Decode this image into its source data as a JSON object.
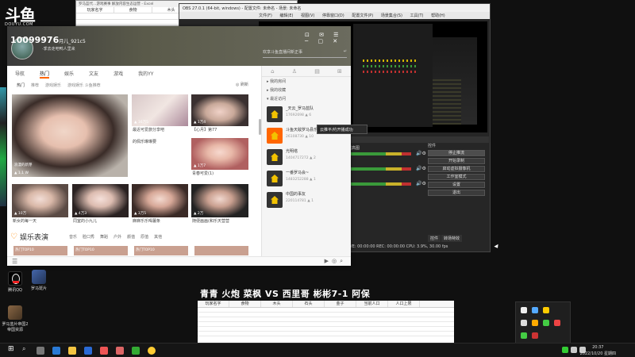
{
  "logo": {
    "mark": "斗鱼",
    "sub": "DOUYU.COM"
  },
  "sheet_top": {
    "title": "罗马蓝代…游戏赛事 解放内容生态运营 - Excel",
    "headers": [
      "玩家名字",
      "食物",
      "木头",
      "",
      ""
    ]
  },
  "obs": {
    "title": "OBS 27.0.1 (64-bit, windows) - 配置文件: 未命名 - 场景: 未命名",
    "menu": [
      "文件(F)",
      "编辑(E)",
      "视图(V)",
      "停靠窗口(D)",
      "配置文件(P)",
      "场景集合(S)",
      "工具(T)",
      "帮助(H)"
    ],
    "dock_tabs": "场景  来源  混音器  场景过渡  控件",
    "mixer": [
      {
        "label": "提高图",
        "level": 0.85
      },
      {
        "label": "",
        "level": 0.75
      },
      {
        "label": "",
        "level": 0.7
      }
    ],
    "controls": [
      "停止推流",
      "开始录制",
      "启动虚拟摄像机",
      "工作室模式",
      "设置",
      "退出"
    ],
    "tabs": [
      "控件",
      "转场特效"
    ],
    "status": "LIVE: 00:00:00   REC: 00:00:00   CPU: 3.9%, 30.00 fps"
  },
  "client": {
    "uid": "10099976",
    "uid_suffix": "月儿_921c5",
    "sign": "·季去走吧鸭人里来",
    "search_placeholder": "欢享斗鱼直播间新正事",
    "winbtns": "⊡ ✉ ☰ ─ ▢ ✕",
    "nav": [
      "导航",
      "热门",
      "娱乐",
      "文友",
      "游戏",
      "我的YY"
    ],
    "subnav": [
      "热门",
      "推荐",
      "游戏娱乐",
      "游戏娱乐 斗鱼推荐"
    ],
    "refresh": "◎ 刷新",
    "tiles": [
      {
        "overlay": "▲ 1.1 W",
        "caption": "",
        "badge": "浪漫的新芽"
      },
      {
        "overlay": "▲ 16万5",
        "caption": "最近可爱旅分享吧"
      },
      {
        "overlay": "▲ 1万4",
        "caption": "【心月】第77"
      },
      {
        "overlay": "",
        "caption": "的佩乐琳琳要"
      },
      {
        "overlay": "▲ 1万7",
        "caption": "青春可爱(1)"
      },
      {
        "overlay": "▲ 10万",
        "caption": "新女的每一天"
      },
      {
        "overlay": "▲ 4万3",
        "caption": "同室的小九儿"
      },
      {
        "overlay": "▲ 3万5",
        "caption": "麻麻乐乐喝薯条"
      },
      {
        "overlay": "▲ 2万",
        "caption": "随便画画(和乐天营营"
      }
    ],
    "section_title": "娱乐表演",
    "section_tabs": [
      "音乐",
      "脸口秀",
      "舞蹈",
      "户外",
      "颜值",
      "原值",
      "其他"
    ],
    "next_row": [
      "热门TOP10",
      "热门TOP10",
      "热门TOP10",
      ""
    ],
    "side_links": [
      "我的房间",
      "我的收藏",
      "最近访问"
    ],
    "side_items": [
      {
        "name": "_天云_罗马蓝队",
        "views": "17692698 ▲ 6"
      },
      {
        "name": "斗鱼天敌罗马县乐楼",
        "views": "26108730 ▲ 10"
      },
      {
        "name": "光明塔",
        "views": "1404717272 ▲ 2"
      },
      {
        "name": "一番罗马会~",
        "views": "1483252288 ▲ 1"
      },
      {
        "name": "中国的事友",
        "views": "220114781 ▲ 1"
      }
    ]
  },
  "tooltip": "云推平/约开播成功",
  "banner": "青青 火炮 菜枫 VS 西里哥 彬彬7-1 阿保",
  "sheet": {
    "headers": [
      "玩家名字",
      "食物",
      "木头",
      "石头",
      "金子",
      "当前人口",
      "人口上限"
    ]
  },
  "desktop_icons": [
    {
      "label": "腾讯QQ"
    },
    {
      "label": "罗马斑片"
    },
    {
      "label": "罗马蓝片帝国2帝国资源"
    }
  ],
  "clock": {
    "time": "20:37",
    "date": "2022/10/20 星期四"
  }
}
